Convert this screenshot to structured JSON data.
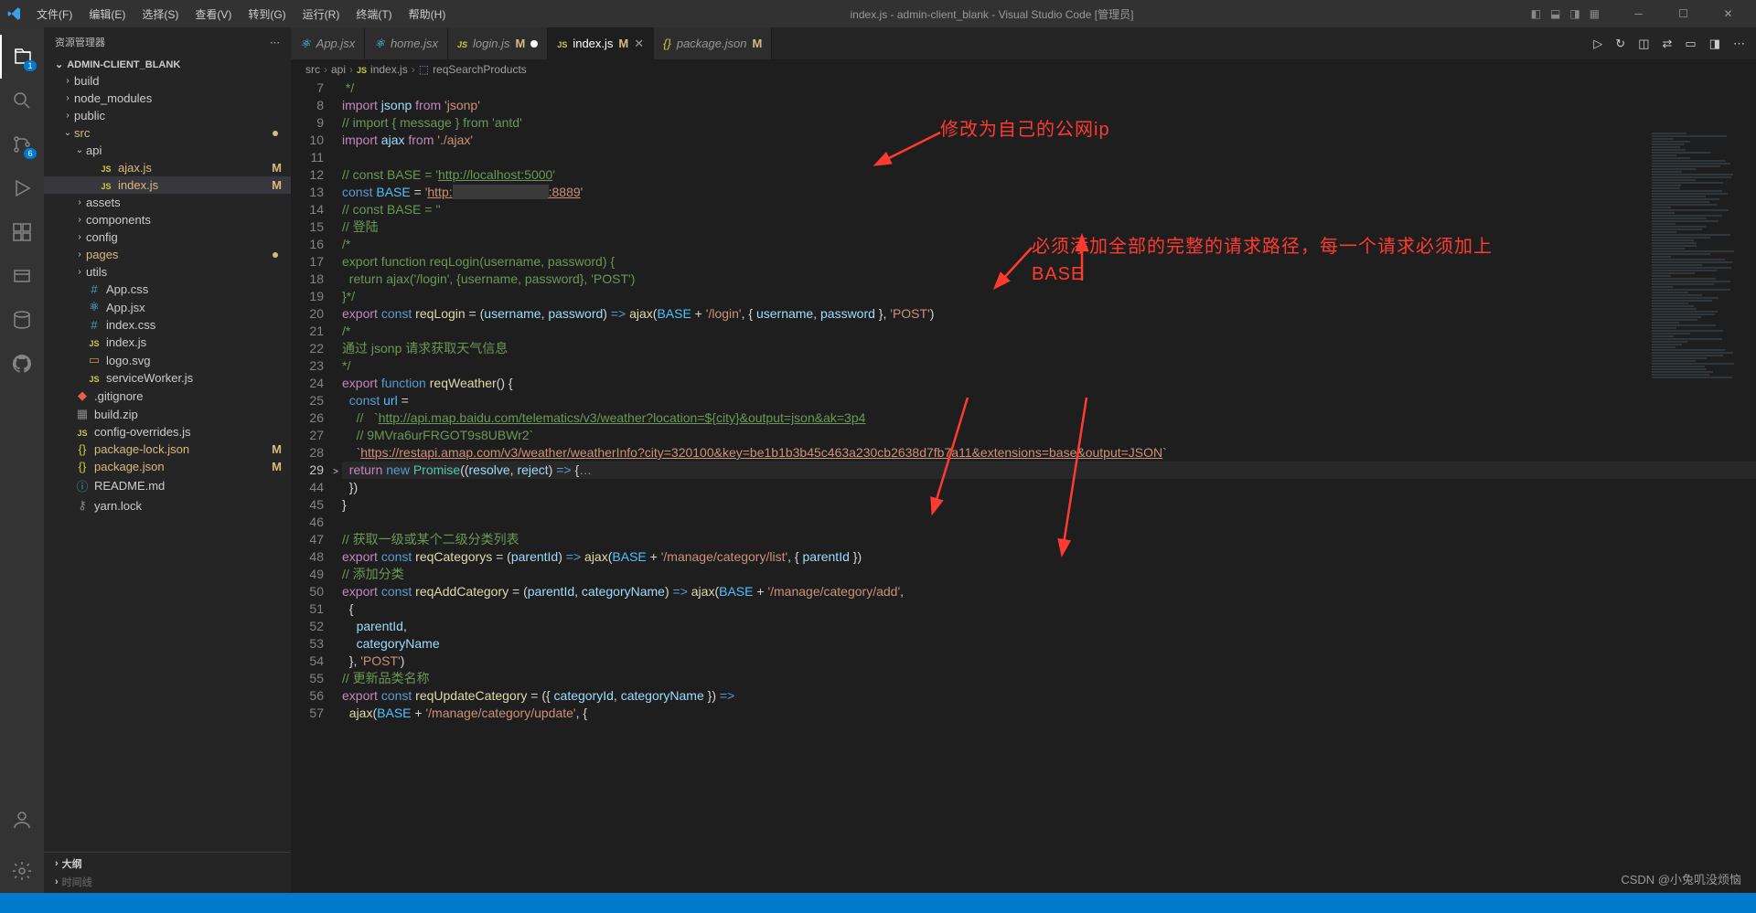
{
  "titlebar": {
    "menus": [
      "文件(F)",
      "编辑(E)",
      "选择(S)",
      "查看(V)",
      "转到(G)",
      "运行(R)",
      "终端(T)",
      "帮助(H)"
    ],
    "title": "index.js - admin-client_blank - Visual Studio Code [管理员]"
  },
  "activitybar": {
    "explorer_badge": "1",
    "scm_badge": "6"
  },
  "sidebar": {
    "header": "资源管理器",
    "project": "ADMIN-CLIENT_BLANK",
    "tree": [
      {
        "type": "folder",
        "name": "build",
        "depth": 1,
        "open": false
      },
      {
        "type": "folder",
        "name": "node_modules",
        "depth": 1,
        "open": false
      },
      {
        "type": "folder",
        "name": "public",
        "depth": 1,
        "open": false
      },
      {
        "type": "folder",
        "name": "src",
        "depth": 1,
        "open": true,
        "dot": true
      },
      {
        "type": "folder",
        "name": "api",
        "depth": 2,
        "open": true
      },
      {
        "type": "file",
        "name": "ajax.js",
        "depth": 3,
        "icon": "js",
        "mod": "M"
      },
      {
        "type": "file",
        "name": "index.js",
        "depth": 3,
        "icon": "js",
        "mod": "M",
        "selected": true
      },
      {
        "type": "folder",
        "name": "assets",
        "depth": 2,
        "open": false
      },
      {
        "type": "folder",
        "name": "components",
        "depth": 2,
        "open": false
      },
      {
        "type": "folder",
        "name": "config",
        "depth": 2,
        "open": false
      },
      {
        "type": "folder",
        "name": "pages",
        "depth": 2,
        "open": false,
        "dot": true
      },
      {
        "type": "folder",
        "name": "utils",
        "depth": 2,
        "open": false
      },
      {
        "type": "file",
        "name": "App.css",
        "depth": 2,
        "icon": "css"
      },
      {
        "type": "file",
        "name": "App.jsx",
        "depth": 2,
        "icon": "react"
      },
      {
        "type": "file",
        "name": "index.css",
        "depth": 2,
        "icon": "css"
      },
      {
        "type": "file",
        "name": "index.js",
        "depth": 2,
        "icon": "js"
      },
      {
        "type": "file",
        "name": "logo.svg",
        "depth": 2,
        "icon": "svg"
      },
      {
        "type": "file",
        "name": "serviceWorker.js",
        "depth": 2,
        "icon": "js"
      },
      {
        "type": "file",
        "name": ".gitignore",
        "depth": 1,
        "icon": "git"
      },
      {
        "type": "file",
        "name": "build.zip",
        "depth": 1,
        "icon": "zip"
      },
      {
        "type": "file",
        "name": "config-overrides.js",
        "depth": 1,
        "icon": "js"
      },
      {
        "type": "file",
        "name": "package-lock.json",
        "depth": 1,
        "icon": "json",
        "mod": "M"
      },
      {
        "type": "file",
        "name": "package.json",
        "depth": 1,
        "icon": "json",
        "mod": "M"
      },
      {
        "type": "file",
        "name": "README.md",
        "depth": 1,
        "icon": "md"
      },
      {
        "type": "file",
        "name": "yarn.lock",
        "depth": 1,
        "icon": "lock"
      }
    ],
    "outline": "大纲"
  },
  "tabs": [
    {
      "label": "App.jsx",
      "icon": "react",
      "modified": false
    },
    {
      "label": "home.jsx",
      "icon": "react",
      "modified": false
    },
    {
      "label": "login.js",
      "icon": "js",
      "mark": "M",
      "dirty": true
    },
    {
      "label": "index.js",
      "icon": "js",
      "mark": "M",
      "active": true,
      "close": true
    },
    {
      "label": "package.json",
      "icon": "json",
      "mark": "M"
    }
  ],
  "breadcrumb": [
    "src",
    "api",
    "index.js",
    "reqSearchProducts"
  ],
  "breadcrumb_icons": [
    "",
    "",
    "js",
    "cube"
  ],
  "code_lines": [
    {
      "n": 7,
      "html": " <span class='tok-c'>*/</span>"
    },
    {
      "n": 8,
      "html": "<span class='tok-k'>import</span> <span class='tok-v'>jsonp</span> <span class='tok-k'>from</span> <span class='tok-s'>'jsonp'</span>"
    },
    {
      "n": 9,
      "html": "<span class='tok-c'>// import { message } from 'antd'</span>"
    },
    {
      "n": 10,
      "html": "<span class='tok-k'>import</span> <span class='tok-v'>ajax</span> <span class='tok-k'>from</span> <span class='tok-s'>'./ajax'</span>"
    },
    {
      "n": 11,
      "html": ""
    },
    {
      "n": 12,
      "html": "<span class='tok-c'>// const BASE = '</span><span class='tok-link'>http://localhost:5000</span><span class='tok-c'>'</span>"
    },
    {
      "n": 13,
      "html": "<span class='tok-kw'>const</span> <span class='tok-const'>BASE</span> = <span class='tok-s'>'<u>http:</u></span><span style='background:#3a3a3a;color:#3a3a3a'>xxxxxxxxxxxxxxx</span><span class='tok-s'><u>:8889</u>'</span>"
    },
    {
      "n": 14,
      "html": "<span class='tok-c'>// const BASE = ''</span>"
    },
    {
      "n": 15,
      "html": "<span class='tok-c'>// 登陆</span>"
    },
    {
      "n": 16,
      "html": "<span class='tok-c'>/*</span>"
    },
    {
      "n": 17,
      "html": "<span class='tok-c'>export function reqLogin(username, password) {</span>"
    },
    {
      "n": 18,
      "html": "<span class='tok-c'>  return ajax('/login', {username, password}, 'POST')</span>"
    },
    {
      "n": 19,
      "html": "<span class='tok-c'>}*/</span>"
    },
    {
      "n": 20,
      "html": "<span class='tok-k'>export</span> <span class='tok-kw'>const</span> <span class='tok-f'>reqLogin</span> = (<span class='tok-v'>username</span>, <span class='tok-v'>password</span>) <span class='tok-kw'>=></span> <span class='tok-f'>ajax</span>(<span class='tok-const'>BASE</span> + <span class='tok-s'>'/login'</span>, { <span class='tok-v'>username</span>, <span class='tok-v'>password</span> }, <span class='tok-s'>'POST'</span>)"
    },
    {
      "n": 21,
      "html": "<span class='tok-c'>/*</span>"
    },
    {
      "n": 22,
      "html": "<span class='tok-c'>通过 jsonp 请求获取天气信息</span>"
    },
    {
      "n": 23,
      "html": "<span class='tok-c'>*/</span>"
    },
    {
      "n": 24,
      "html": "<span class='tok-k'>export</span> <span class='tok-kw'>function</span> <span class='tok-f'>reqWeather</span>() {"
    },
    {
      "n": 25,
      "html": "  <span class='tok-kw'>const</span> <span class='tok-const'>url</span> ="
    },
    {
      "n": 26,
      "html": "    <span class='tok-c'>//   `</span><span class='tok-link'>http://api.map.baidu.com/telematics/v3/weather?location=${city}&output=json&ak=3p4</span>"
    },
    {
      "n": 27,
      "html": "    <span class='tok-c'>// 9MVra6urFRGOT9s8UBWr2`</span>"
    },
    {
      "n": 28,
      "html": "    <span class='tok-s'>`<u>https://restapi.amap.com/v3/weather/weatherInfo?city=320100&key=be1b1b3b45c463a230cb2638d7fb7a11&extensions=base&output=JSON</u>`</span>"
    },
    {
      "n": 29,
      "html": "  <span class='tok-k'>return</span> <span class='tok-kw'>new</span> <span class='tok-t'>Promise</span>((<span class='tok-v'>resolve</span>, <span class='tok-v'>reject</span>) <span class='tok-kw'>=></span> {<span style='color:#888'>…</span>",
      "hl": true,
      "fold": ">"
    },
    {
      "n": 44,
      "html": "  })"
    },
    {
      "n": 45,
      "html": "}"
    },
    {
      "n": 46,
      "html": ""
    },
    {
      "n": 47,
      "html": "<span class='tok-c'>// 获取一级或某个二级分类列表</span>"
    },
    {
      "n": 48,
      "html": "<span class='tok-k'>export</span> <span class='tok-kw'>const</span> <span class='tok-f'>reqCategorys</span> = (<span class='tok-v'>parentId</span>) <span class='tok-kw'>=></span> <span class='tok-f'>ajax</span>(<span class='tok-const'>BASE</span> + <span class='tok-s'>'/manage/category/list'</span>, { <span class='tok-v'>parentId</span> })"
    },
    {
      "n": 49,
      "html": "<span class='tok-c'>// 添加分类</span>"
    },
    {
      "n": 50,
      "html": "<span class='tok-k'>export</span> <span class='tok-kw'>const</span> <span class='tok-f'>reqAddCategory</span> = (<span class='tok-v'>parentId</span>, <span class='tok-v'>categoryName</span>) <span class='tok-kw'>=></span> <span class='tok-f'>ajax</span>(<span class='tok-const'>BASE</span> + <span class='tok-s'>'/manage/category/add'</span>,"
    },
    {
      "n": 51,
      "html": "  {"
    },
    {
      "n": 52,
      "html": "    <span class='tok-v'>parentId</span>,"
    },
    {
      "n": 53,
      "html": "    <span class='tok-v'>categoryName</span>"
    },
    {
      "n": 54,
      "html": "  }, <span class='tok-s'>'POST'</span>)"
    },
    {
      "n": 55,
      "html": "<span class='tok-c'>// 更新品类名称</span>"
    },
    {
      "n": 56,
      "html": "<span class='tok-k'>export</span> <span class='tok-kw'>const</span> <span class='tok-f'>reqUpdateCategory</span> = ({ <span class='tok-v'>categoryId</span>, <span class='tok-v'>categoryName</span> }) <span class='tok-kw'>=></span>"
    },
    {
      "n": 57,
      "html": "  <span class='tok-f'>ajax</span>(<span class='tok-const'>BASE</span> + <span class='tok-s'>'/manage/category/update'</span>, {"
    }
  ],
  "annotations": {
    "a1": "修改为自己的公网ip",
    "a2_line1": "必须添加全部的完整的请求路径，每一个请求必须加上",
    "a2_line2": "BASE"
  },
  "watermark": "CSDN @小兔叽没烦恼"
}
